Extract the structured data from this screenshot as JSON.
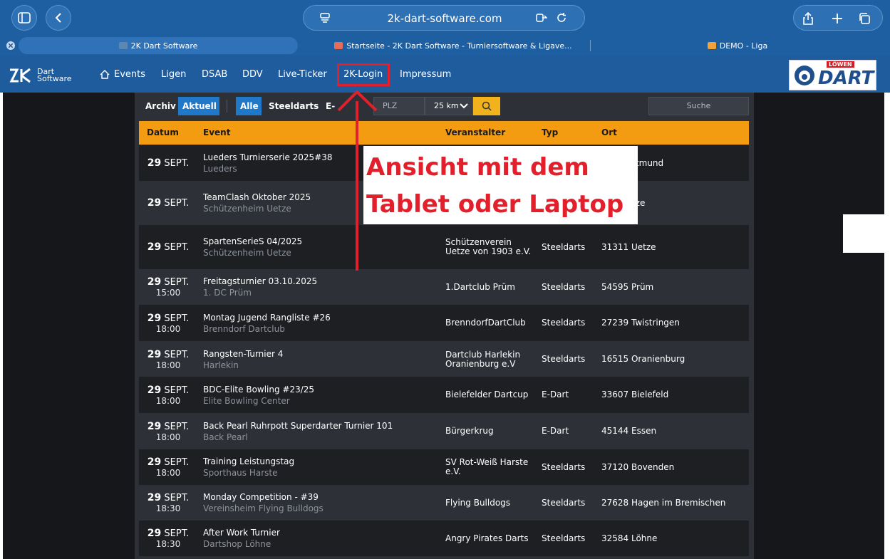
{
  "browser": {
    "url": "2k-dart-software.com",
    "tabs": [
      {
        "label": "2K Dart Software",
        "icon": "2k-favicon"
      },
      {
        "label": "Startseite - 2K Dart Software - Turniersoftware & Ligave...",
        "icon": "2k-favicon"
      },
      {
        "label": "DEMO - Liga",
        "icon": "joomla-favicon"
      }
    ],
    "close_icon": "close-icon"
  },
  "site": {
    "logo_line1": "Dart",
    "logo_line2": "Software",
    "nav": [
      {
        "label": "Events",
        "icon": "home-icon"
      },
      {
        "label": "Ligen"
      },
      {
        "label": "DSAB"
      },
      {
        "label": "DDV"
      },
      {
        "label": "Live-Ticker"
      },
      {
        "label": "2K-Login"
      },
      {
        "label": "Impressum"
      }
    ],
    "partner_logo_top": "LÖWEN",
    "partner_logo_main": "DART"
  },
  "filters": {
    "archiv": "Archiv",
    "aktuell": "Aktuell",
    "alle": "Alle",
    "steeldarts": "Steeldarts",
    "edart": "E-Dart",
    "plz_placeholder": "PLZ",
    "radius": "25 km",
    "search_placeholder": "Suche"
  },
  "table": {
    "headers": {
      "datum": "Datum",
      "event": "Event",
      "veranstalter": "Veranstalter",
      "typ": "Typ",
      "ort": "Ort"
    },
    "rows": [
      {
        "day": "29",
        "month": "SEPT.",
        "time": "",
        "name": "Lueders Turnierserie 2025#38",
        "sub": "Lueders",
        "org": "",
        "typ": "",
        "ort": "rtmund"
      },
      {
        "day": "29",
        "month": "SEPT.",
        "time": "",
        "name": "TeamClash Oktober 2025",
        "sub": "Schützenheim Uetze",
        "org": "",
        "typ": "",
        "ort": "tze"
      },
      {
        "day": "29",
        "month": "SEPT.",
        "time": "",
        "name": "SpartenSerieS 04/2025",
        "sub": "Schützenheim Uetze",
        "org": "Schützenverein Uetze von 1903 e.V.",
        "typ": "Steeldarts",
        "ort": "31311 Uetze"
      },
      {
        "day": "29",
        "month": "SEPT.",
        "time": "15:00",
        "name": "Freitagsturnier 03.10.2025",
        "sub": "1. DC Prüm",
        "org": "1.Dartclub Prüm",
        "typ": "Steeldarts",
        "ort": "54595 Prüm"
      },
      {
        "day": "29",
        "month": "SEPT.",
        "time": "18:00",
        "name": "Montag Jugend Rangliste #26",
        "sub": "Brenndorf Dartclub",
        "org": "BrenndorfDartClub",
        "typ": "Steeldarts",
        "ort": "27239 Twistringen"
      },
      {
        "day": "29",
        "month": "SEPT.",
        "time": "18:00",
        "name": "Rangsten-Turnier 4",
        "sub": "Harlekin",
        "org": "Dartclub Harlekin Oranienburg e.V",
        "typ": "Steeldarts",
        "ort": "16515 Oranienburg"
      },
      {
        "day": "29",
        "month": "SEPT.",
        "time": "18:00",
        "name": "BDC-Elite Bowling #23/25",
        "sub": "Elite Bowling Center",
        "org": "Bielefelder Dartcup",
        "typ": "E-Dart",
        "ort": "33607 Bielefeld"
      },
      {
        "day": "29",
        "month": "SEPT.",
        "time": "18:00",
        "name": "Back Pearl Ruhrpott Superdarter Turnier 101",
        "sub": "Back Pearl",
        "org": "Bürgerkrug",
        "typ": "E-Dart",
        "ort": "45144 Essen"
      },
      {
        "day": "29",
        "month": "SEPT.",
        "time": "18:00",
        "name": "Training Leistungstag",
        "sub": "Sporthaus Harste",
        "org": "SV Rot-Weiß Harste e.V.",
        "typ": "Steeldarts",
        "ort": "37120 Bovenden"
      },
      {
        "day": "29",
        "month": "SEPT.",
        "time": "18:30",
        "name": "Monday Competition - #39",
        "sub": "Vereinsheim Flying Bulldogs",
        "org": "Flying Bulldogs",
        "typ": "Steeldarts",
        "ort": "27628 Hagen im Bremischen"
      },
      {
        "day": "29",
        "month": "SEPT.",
        "time": "18:30",
        "name": "After Work Turnier",
        "sub": "Dartshop Löhne",
        "org": "Angry Pirates Darts",
        "typ": "Steeldarts",
        "ort": "32584 Löhne"
      }
    ]
  },
  "annotation": {
    "line1": "Ansicht mit dem",
    "line2": "Tablet oder Laptop",
    "color": "#e2202c"
  },
  "colors": {
    "header_orange": "#f39c12",
    "nav_blue": "#1f5c9e",
    "accent_blue": "#1f78c8"
  }
}
